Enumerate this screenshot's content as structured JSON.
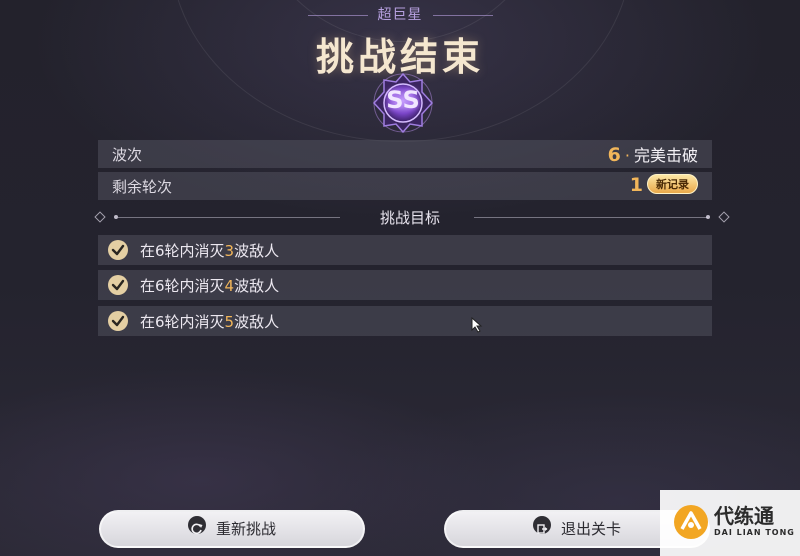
{
  "header": {
    "difficulty": "超巨星",
    "title": "挑战结束",
    "rank": "SS"
  },
  "stats": [
    {
      "label": "波次",
      "value_number": "6",
      "value_text": "完美击破"
    },
    {
      "label": "剩余轮次",
      "value_number": "1",
      "badge": "新记录"
    }
  ],
  "objectives": {
    "title": "挑战目标",
    "items": [
      {
        "prefix": "在6轮内消灭",
        "count": "3",
        "suffix": "波敌人",
        "completed": true
      },
      {
        "prefix": "在6轮内消灭",
        "count": "4",
        "suffix": "波敌人",
        "completed": true
      },
      {
        "prefix": "在6轮内消灭",
        "count": "5",
        "suffix": "波敌人",
        "completed": true
      }
    ]
  },
  "actions": {
    "retry_label": "重新挑战",
    "exit_label": "退出关卡"
  },
  "watermark": {
    "name": "代练通",
    "subtitle": "DAI LIAN TONG"
  },
  "colors": {
    "accent": "#f2b65a",
    "rank_purple": "#8b5cd6",
    "check": "#e4cfa3"
  }
}
